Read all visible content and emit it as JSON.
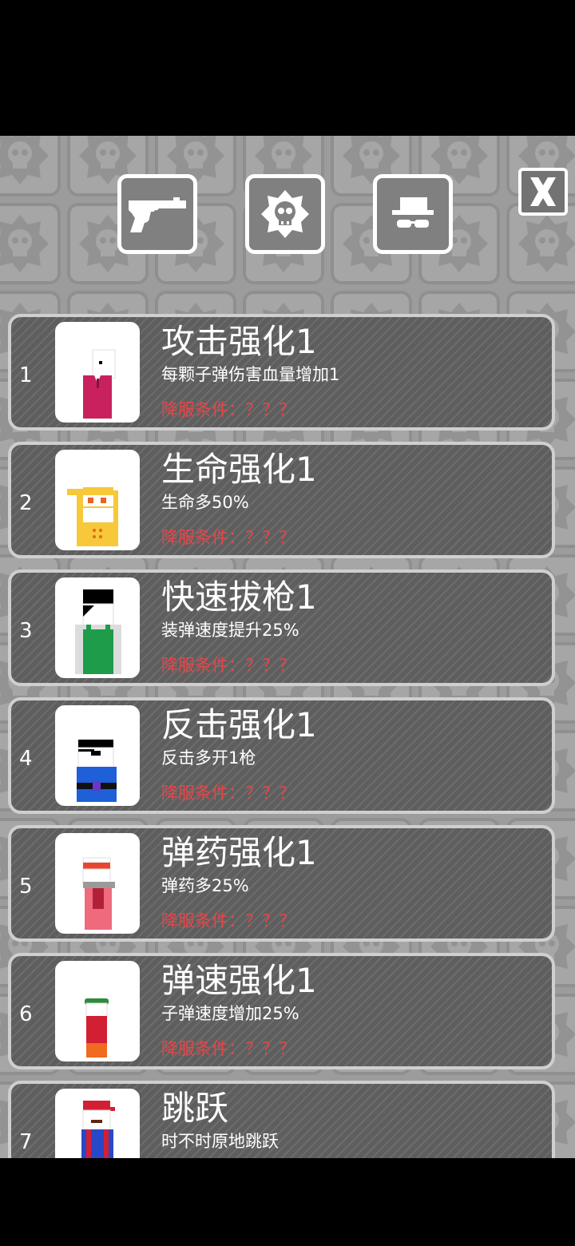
{
  "tabs": [
    {
      "name": "revolver-icon"
    },
    {
      "name": "skull-badge-icon"
    },
    {
      "name": "hat-glasses-icon"
    }
  ],
  "close": {
    "icon": "close-x-icon"
  },
  "skills": [
    {
      "num": "1",
      "title": "攻击强化1",
      "desc": "每颗子弹伤害血量增加1",
      "cond": "降服条件：？？？",
      "char": "suit"
    },
    {
      "num": "2",
      "title": "生命强化1",
      "desc": "生命多50%",
      "cond": "降服条件：？？？",
      "char": "bandana"
    },
    {
      "num": "3",
      "title": "快速拔枪1",
      "desc": "装弹速度提升25%",
      "cond": "降服条件：？？？",
      "char": "overalls"
    },
    {
      "num": "4",
      "title": "反击强化1",
      "desc": "反击多开1枪",
      "cond": "降服条件：？？？",
      "char": "eyepatch"
    },
    {
      "num": "5",
      "title": "弹药强化1",
      "desc": "弹药多25%",
      "cond": "降服条件：？？？",
      "char": "headband"
    },
    {
      "num": "6",
      "title": "弹速强化1",
      "desc": "子弹速度增加25%",
      "cond": "降服条件：？？？",
      "char": "green-cap"
    },
    {
      "num": "7",
      "title": "跳跃",
      "desc": "时不时原地跳跃",
      "cond": "",
      "char": "red-cap"
    }
  ],
  "colors": {
    "condition": "#e4474a",
    "card": "#5e5e5e",
    "background": "#9c9c9c"
  }
}
